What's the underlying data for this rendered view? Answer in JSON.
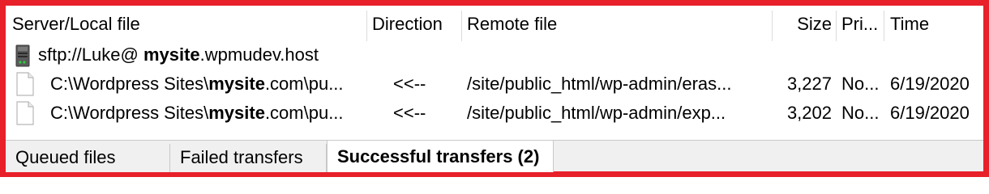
{
  "columns": {
    "local": "Server/Local file",
    "direction": "Direction",
    "remote": "Remote file",
    "size": "Size",
    "priority": "Pri...",
    "time": "Time"
  },
  "server": {
    "icon": "server-icon",
    "prefix": "sftp://Luke@ ",
    "host_bold": "mysite",
    "suffix": ".wpmudev.host"
  },
  "rows": [
    {
      "icon": "file-icon",
      "local_prefix": "C:\\Wordpress Sites\\",
      "local_bold": "mysite",
      "local_suffix": ".com\\pu...",
      "direction": "<<--",
      "remote": "/site/public_html/wp-admin/eras...",
      "size": "3,227",
      "priority": "No...",
      "time": "6/19/2020"
    },
    {
      "icon": "file-icon",
      "local_prefix": "C:\\Wordpress Sites\\",
      "local_bold": "mysite",
      "local_suffix": ".com\\pu...",
      "direction": "<<--",
      "remote": "/site/public_html/wp-admin/exp...",
      "size": "3,202",
      "priority": "No...",
      "time": "6/19/2020"
    }
  ],
  "tabs": {
    "queued": "Queued files",
    "failed": "Failed transfers",
    "successful": "Successful transfers (2)"
  },
  "colors": {
    "frame": "#e8202a"
  }
}
